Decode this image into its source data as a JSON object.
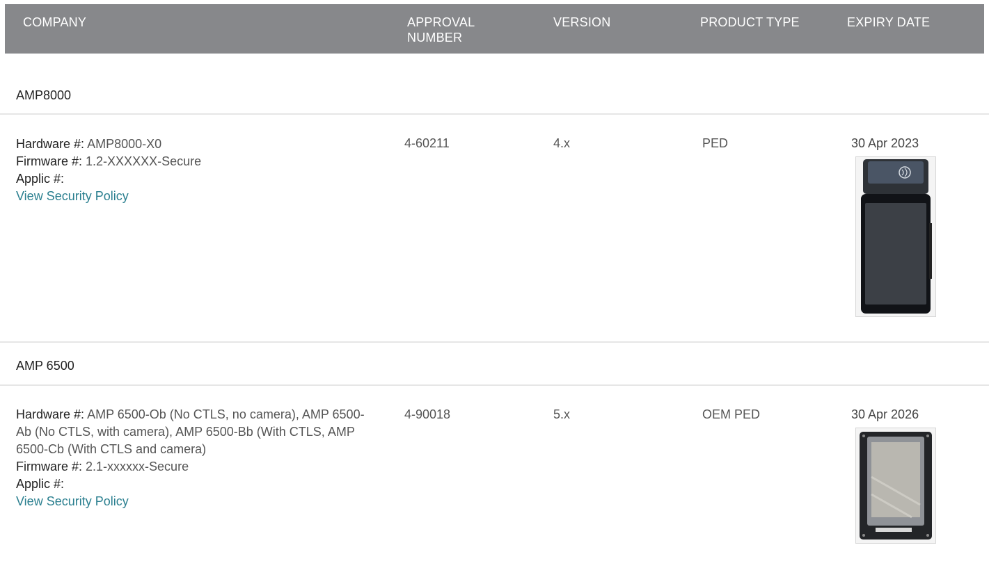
{
  "header": {
    "company": "COMPANY",
    "approval_number": "APPROVAL NUMBER",
    "version": "VERSION",
    "product_type": "PRODUCT TYPE",
    "expiry_date": "EXPIRY DATE"
  },
  "products": [
    {
      "name": "AMP8000",
      "hardware_label": "Hardware #:",
      "hardware": "AMP8000-X0",
      "firmware_label": "Firmware #:",
      "firmware": "1.2-XXXXXX-Secure",
      "applic_label": "Applic #:",
      "applic": "",
      "policy_link": "View Security Policy",
      "approval_number": "4-60211",
      "version": "4.x",
      "product_type": "PED",
      "expiry_date": "30 Apr 2023",
      "image_icon": "pos-terminal-image"
    },
    {
      "name": "AMP 6500",
      "hardware_label": "Hardware #:",
      "hardware": "AMP 6500-Ob (No CTLS, no camera), AMP 6500-Ab (No CTLS, with camera), AMP 6500-Bb (With CTLS, AMP 6500-Cb (With CTLS and camera)",
      "firmware_label": "Firmware #:",
      "firmware": "2.1-xxxxxx-Secure",
      "applic_label": "Applic #:",
      "applic": "",
      "policy_link": "View Security Policy",
      "approval_number": "4-90018",
      "version": "5.x",
      "product_type": "OEM PED",
      "expiry_date": "30 Apr 2026",
      "image_icon": "oem-module-image"
    }
  ],
  "colors": {
    "header_bg": "#87888b",
    "link": "#2a7f8f",
    "divider": "#e6e6e6"
  }
}
